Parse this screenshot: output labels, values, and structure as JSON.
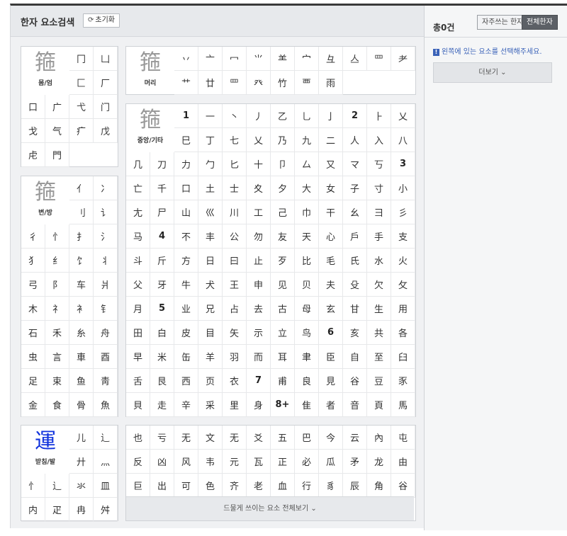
{
  "header": {
    "title": "한자 요소검색",
    "reset_label": "초기화",
    "reset_icon": "refresh-icon"
  },
  "right": {
    "count": "총0건",
    "toggle_frequent": "자주쓰는 한자",
    "toggle_all": "전체한자",
    "hint": "왼쪽에 있는 요소를 선택해주세요.",
    "more": "더보기 ⌄"
  },
  "colors": {
    "highlight": "#1133dd",
    "hint": "#3a62b8",
    "active_toggle": "#5c6066"
  },
  "panels": {
    "body": {
      "big_char": "箍",
      "caption": "몸/엄",
      "cells": [
        "冂",
        "凵",
        "匚",
        "厂",
        "口",
        "广",
        "弋",
        "门",
        "戈",
        "气",
        "疒",
        "戊",
        "虍",
        "門"
      ]
    },
    "side": {
      "big_char": "箍",
      "caption": "변/방",
      "cells": [
        "亻",
        "冫",
        "刂",
        "讠",
        "彳",
        "忄",
        "扌",
        "氵",
        "犭",
        "纟",
        "饣",
        "丬",
        "弓",
        "阝",
        "车",
        "爿",
        "木",
        "礻",
        "衤",
        "钅",
        "石",
        "禾",
        "糸",
        "舟",
        "虫",
        "言",
        "車",
        "酉",
        "足",
        "束",
        "鱼",
        "靑",
        "金",
        "食",
        "骨",
        "魚"
      ]
    },
    "bottom": {
      "big_char": "運",
      "caption": "받침/발",
      "cells": [
        "儿",
        "辶",
        "廾",
        "灬",
        "忄",
        "辶",
        "氺",
        "皿",
        "内",
        "疋",
        "冉",
        "舛"
      ]
    },
    "head": {
      "big_char": "箍",
      "caption": "머리",
      "cells": [
        "丷",
        "亠",
        "冖",
        "⺌",
        "⺷",
        "宀",
        "彑",
        "亼",
        "罒",
        "耂",
        "艹",
        "廿",
        "罒",
        "癶",
        "竹",
        "覀",
        "雨"
      ]
    },
    "middle": {
      "big_char": "箍",
      "caption": "중앙/기타",
      "cells": [
        "1",
        "一",
        "丶",
        "丿",
        "乙",
        "乚",
        "亅",
        "2",
        "⺊",
        "乂",
        "巳",
        "丁",
        "七",
        "乂",
        "乃",
        "九",
        "二",
        "人",
        "入",
        "八",
        "几",
        "刀",
        "力",
        "勹",
        "匕",
        "十",
        "卩",
        "厶",
        "又",
        "マ",
        "丂",
        "3",
        "亡",
        "千",
        "口",
        "土",
        "士",
        "夊",
        "夕",
        "大",
        "女",
        "子",
        "寸",
        "小",
        "尢",
        "尸",
        "山",
        "巛",
        "川",
        "工",
        "己",
        "巾",
        "干",
        "幺",
        "彐",
        "彡",
        "马",
        "4",
        "不",
        "丰",
        "公",
        "勿",
        "友",
        "天",
        "心",
        "戶",
        "手",
        "支",
        "斗",
        "斤",
        "方",
        "日",
        "曰",
        "止",
        "歹",
        "比",
        "毛",
        "氏",
        "水",
        "火",
        "父",
        "牙",
        "牛",
        "犬",
        "王",
        "申",
        "见",
        "贝",
        "夫",
        "殳",
        "欠",
        "攵",
        "月",
        "5",
        "业",
        "兄",
        "占",
        "去",
        "古",
        "母",
        "玄",
        "甘",
        "生",
        "用",
        "田",
        "白",
        "皮",
        "目",
        "矢",
        "示",
        "立",
        "鸟",
        "6",
        "亥",
        "共",
        "各",
        "早",
        "米",
        "缶",
        "羊",
        "羽",
        "而",
        "耳",
        "聿",
        "臣",
        "自",
        "至",
        "臼",
        "舌",
        "艮",
        "西",
        "页",
        "衣",
        "7",
        "甫",
        "良",
        "見",
        "谷",
        "豆",
        "豕",
        "貝",
        "走",
        "辛",
        "采",
        "里",
        "身",
        "8+",
        "隹",
        "者",
        "音",
        "頁",
        "馬"
      ]
    },
    "rare": {
      "cells": [
        "也",
        "亏",
        "无",
        "文",
        "无",
        "爻",
        "五",
        "巴",
        "今",
        "云",
        "內",
        "屯",
        "反",
        "凶",
        "风",
        "韦",
        "元",
        "瓦",
        "正",
        "必",
        "瓜",
        "矛",
        "龙",
        "由",
        "巨",
        "出",
        "可",
        "色",
        "齐",
        "老",
        "血",
        "行",
        "豸",
        "辰",
        "角",
        "谷"
      ],
      "more": "드물게 쓰이는 요소 전체보기 ⌄"
    }
  }
}
